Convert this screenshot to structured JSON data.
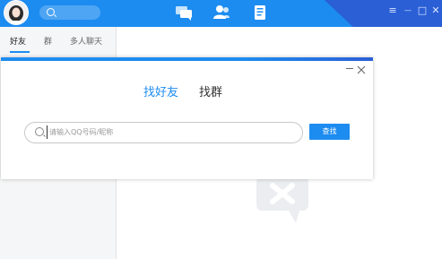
{
  "sidebar": {
    "tabs": [
      {
        "label": "好友"
      },
      {
        "label": "群"
      },
      {
        "label": "多人聊天"
      }
    ]
  },
  "dialog": {
    "tabs": [
      {
        "label": "找好友"
      },
      {
        "label": "找群"
      }
    ],
    "search": {
      "placeholder": "请输入QQ号码/昵称",
      "button_label": "查找"
    }
  },
  "window_controls": {
    "menu_glyph": "≡",
    "minimize_glyph": "—",
    "maximize_glyph": "□",
    "close_glyph": "✕"
  },
  "colors": {
    "brand": "#1d8cf0",
    "header_dark": "#2b5fd6"
  }
}
